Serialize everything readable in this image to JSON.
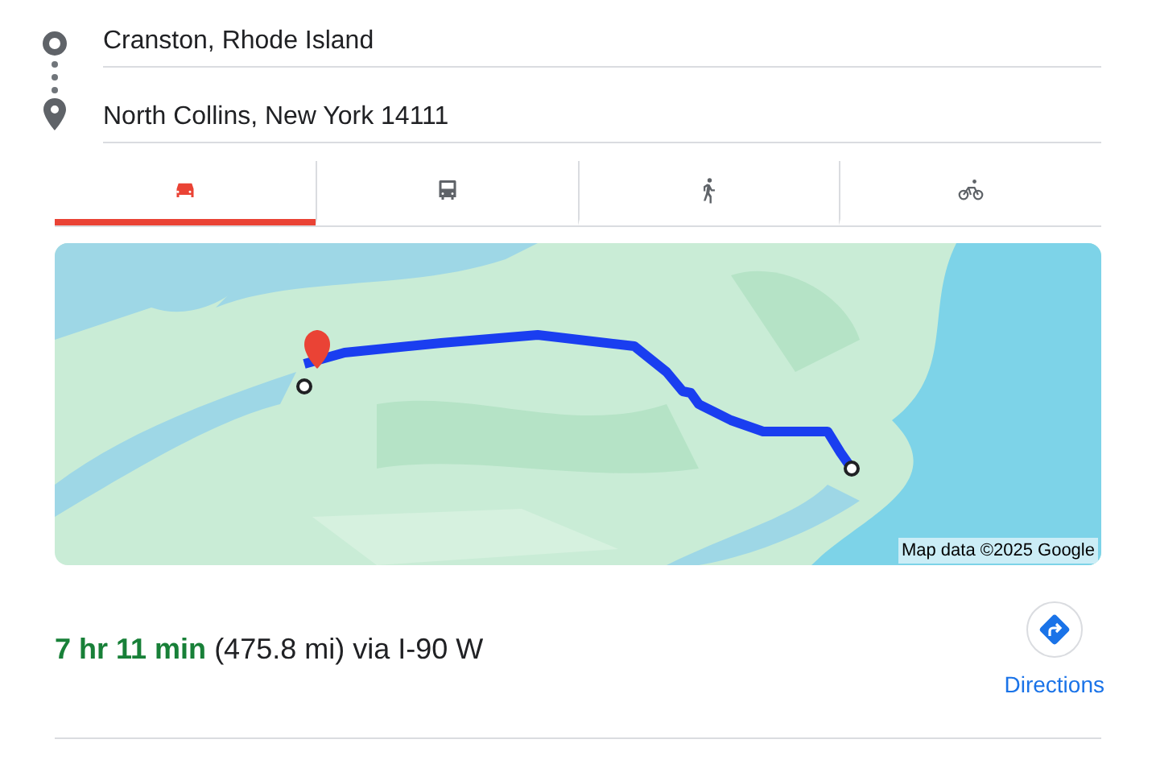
{
  "route": {
    "origin": "Cranston, Rhode Island",
    "destination": "North Collins, New York 14111"
  },
  "modes": [
    {
      "kind": "car",
      "selected": true
    },
    {
      "kind": "transit",
      "selected": false
    },
    {
      "kind": "walk",
      "selected": false
    },
    {
      "kind": "bike",
      "selected": false
    }
  ],
  "map": {
    "attribution": "Map data ©2025 Google"
  },
  "summary": {
    "duration": "7 hr 11 min",
    "detail": "(475.8 mi) via I-90 W"
  },
  "directions_button": {
    "label": "Directions"
  }
}
